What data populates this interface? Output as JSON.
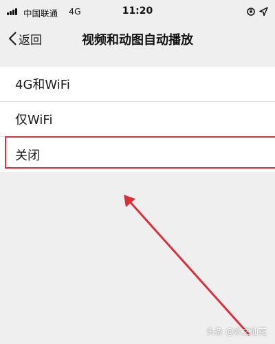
{
  "status_bar": {
    "carrier": "中国联通",
    "network": "4G",
    "time": "11:20",
    "icons": [
      "signal-icon",
      "orientation-lock-icon",
      "location-arrow-icon"
    ]
  },
  "nav": {
    "back_label": "返回",
    "title": "视频和动图自动播放"
  },
  "options": [
    {
      "label": "4G和WiFi"
    },
    {
      "label": "仅WiFi"
    },
    {
      "label": "关闭",
      "highlighted": true
    }
  ],
  "annotation": {
    "color": "#d9313a",
    "points_to": "关闭"
  },
  "watermark": "头条 @水之仙花"
}
